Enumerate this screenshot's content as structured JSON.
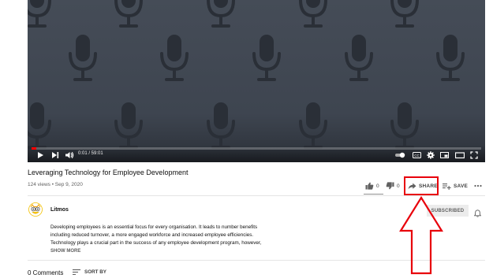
{
  "player": {
    "time_display": "0:01 / 59:01",
    "progress_fraction": 0.01,
    "background_icon": "microphone-icon",
    "accent_color": "#ff0000"
  },
  "video": {
    "title": "Leveraging Technology for Employee Development",
    "meta": "124 views • Sep 9, 2020"
  },
  "actions": {
    "like_count": "0",
    "dislike_count": "0",
    "share_label": "SHARE",
    "save_label": "SAVE"
  },
  "channel": {
    "name": "Litmos",
    "subscribed_label": "SUBSCRIBED"
  },
  "description": {
    "lines": [
      "Developing employees is an essential focus for every organisation. It leads to number benefits",
      "including reduced turnover, a more engaged workforce and increased employee efficiencies.",
      "Technology plays a crucial part in the success of any employee development program, however,"
    ],
    "show_more_label": "SHOW MORE"
  },
  "comments": {
    "count_label": "0 Comments",
    "sort_label": "SORT BY"
  },
  "annotation": {
    "color": "#e8000b"
  }
}
